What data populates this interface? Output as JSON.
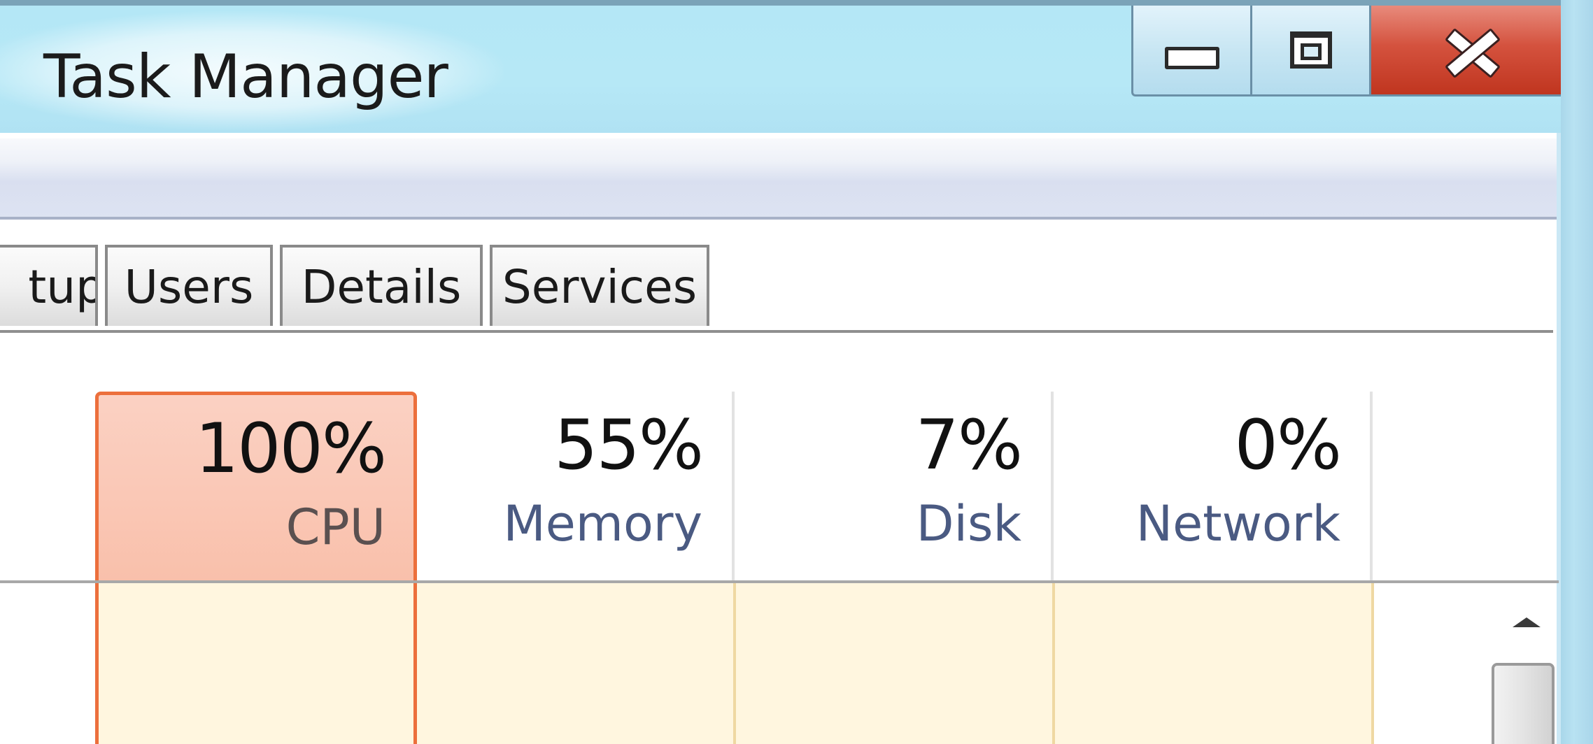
{
  "window": {
    "title": "Task Manager"
  },
  "caption_buttons": {
    "minimize": "minimize-icon",
    "restore": "restore-icon",
    "close": "close-icon"
  },
  "tabs": [
    {
      "label": "tup"
    },
    {
      "label": "Users"
    },
    {
      "label": "Details"
    },
    {
      "label": "Services"
    }
  ],
  "columns": [
    {
      "percent": "100%",
      "label": "CPU"
    },
    {
      "percent": "55%",
      "label": "Memory"
    },
    {
      "percent": "7%",
      "label": "Disk"
    },
    {
      "percent": "0%",
      "label": "Network"
    }
  ],
  "colors": {
    "cpu_highlight": "#f9c0ab",
    "cpu_border": "#ec6f3c",
    "row_fill": "#fff6df",
    "close_button": "#c0351f",
    "titlebar": "#b4e7f6"
  }
}
